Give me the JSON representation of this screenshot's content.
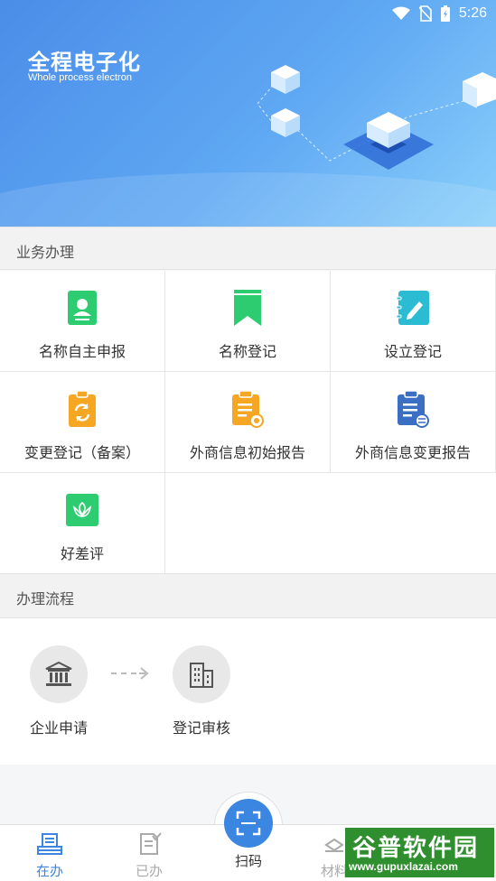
{
  "status_bar": {
    "time": "5:26"
  },
  "hero": {
    "title": "全程电子化",
    "subtitle": "Whole process electron"
  },
  "services": {
    "header": "业务办理",
    "items": [
      {
        "label": "名称自主申报",
        "icon": "id-card-icon",
        "color": "#2ecc71"
      },
      {
        "label": "名称登记",
        "icon": "bookmark-icon",
        "color": "#2ecc71"
      },
      {
        "label": "设立登记",
        "icon": "edit-notebook-icon",
        "color": "#2bbcd4"
      },
      {
        "label": "变更登记（备案）",
        "icon": "refresh-clipboard-icon",
        "color": "#f5a623"
      },
      {
        "label": "外商信息初始报告",
        "icon": "report-clipboard-icon",
        "color": "#f5a623"
      },
      {
        "label": "外商信息变更报告",
        "icon": "change-clipboard-icon",
        "color": "#3a6fc4"
      },
      {
        "label": "好差评",
        "icon": "flower-rating-icon",
        "color": "#2ecc71"
      }
    ]
  },
  "process": {
    "header": "办理流程",
    "steps": [
      {
        "label": "企业申请",
        "icon": "bank-building-icon"
      },
      {
        "label": "登记审核",
        "icon": "office-building-icon"
      }
    ]
  },
  "tabbar": {
    "tabs": [
      {
        "label": "在办",
        "icon": "in-progress-icon",
        "active": true
      },
      {
        "label": "已办",
        "icon": "done-doc-icon",
        "active": false
      },
      {
        "label": "扫码",
        "icon": "scan-icon",
        "active": false
      },
      {
        "label": "材料",
        "icon": "materials-icon",
        "active": false
      }
    ]
  },
  "watermark": {
    "line1": "谷普软件园",
    "line2": "www.gupuxlazai.com"
  },
  "colors": {
    "accent": "#3a86e0",
    "hero_start": "#4a8de8",
    "hero_end": "#8bd0fb"
  }
}
